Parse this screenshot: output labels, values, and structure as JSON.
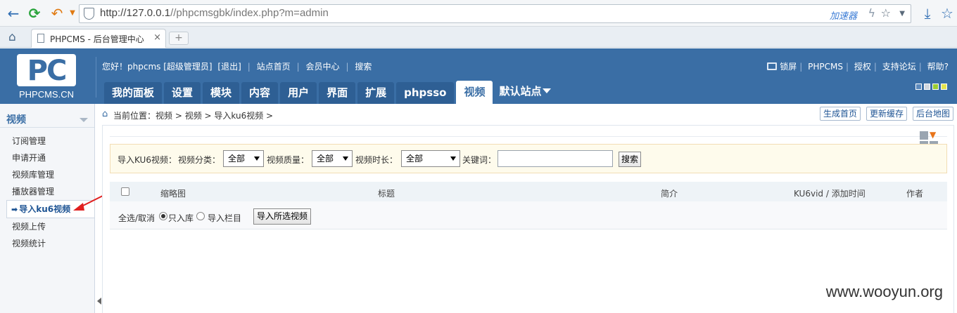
{
  "browser": {
    "url_host": "http://127.0.0.1",
    "url_path": "//phpcmsgbk/index.php?m=admin",
    "accelerator": "加速器",
    "tab_title": "PHPCMS - 后台管理中心",
    "tab_close": "×",
    "new_tab": "+",
    "icons": [
      "back-arrow-icon",
      "refresh-icon",
      "undo-icon",
      "shield-icon",
      "lightning-icon",
      "star-icon",
      "download-icon",
      "home-icon"
    ]
  },
  "header": {
    "logo_text": "PC",
    "logo_sub": "PHPCMS.CN",
    "welcome": "您好！phpcms [超级管理员]",
    "logout": "[退出]",
    "site_home": "站点首页",
    "member_center": "会员中心",
    "search": "搜索",
    "lock": "锁屏",
    "phpcms": "PHPCMS",
    "license": "授权",
    "forum": "支持论坛",
    "help": "帮助?",
    "nav": [
      "我的面板",
      "设置",
      "模块",
      "内容",
      "用户",
      "界面",
      "扩展",
      "phpsso",
      "视频"
    ],
    "site_select": "默认站点",
    "skin_colors": [
      "#5d8abd",
      "#cfd6de",
      "#9acd32",
      "#e4e44e"
    ]
  },
  "sidebar": {
    "title": "视频",
    "items": [
      "订阅管理",
      "申请开通",
      "视频库管理",
      "播放器管理",
      "导入ku6视频",
      "视频上传",
      "视频统计"
    ],
    "active_arrow": "➡"
  },
  "breadcrumb": {
    "label": "当前位置：",
    "path": "视频 > 视频 > 导入ku6视频 >",
    "buttons": [
      "生成首页",
      "更新缓存",
      "后台地图"
    ]
  },
  "filter": {
    "title": "导入KU6视频：",
    "category_label": "视频分类：",
    "category_value": "全部",
    "quality_label": "视频质量：",
    "quality_value": "全部",
    "duration_label": "视频时长：",
    "duration_value": "全部",
    "keyword_label": "关键词：",
    "keyword_value": "",
    "search_button": "搜索"
  },
  "table": {
    "columns": [
      "缩略图",
      "标题",
      "简介",
      "KU6vid / 添加时间",
      "作者"
    ]
  },
  "actions": {
    "select_all": "全选/取消",
    "radio_library": "只入库",
    "radio_column": "导入栏目",
    "import_button": "导入所选视频"
  },
  "watermark": "www.wooyun.org",
  "colors": {
    "header_bg": "#3a6ea5",
    "nav_tab_bg": "#2e5f94",
    "filter_bg": "#fefbec",
    "annotation_red": "#e02020"
  }
}
